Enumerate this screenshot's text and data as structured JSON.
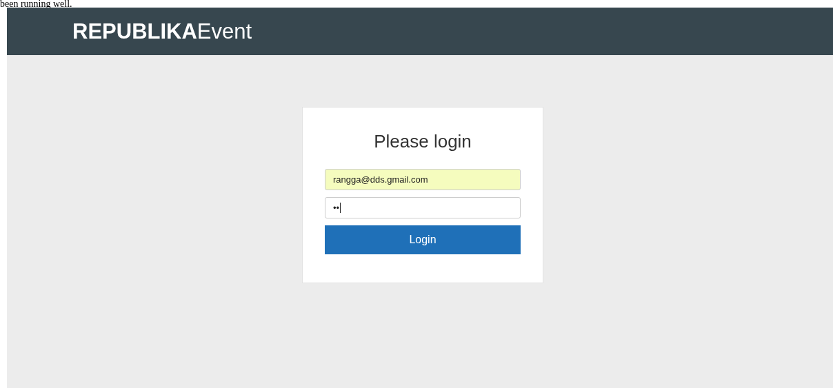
{
  "caption": "been running well.",
  "header": {
    "brand_bold": "REPUBLIKA",
    "brand_light": "Event"
  },
  "login": {
    "title": "Please login",
    "email": {
      "value": "rangga@dds.gmail.com",
      "autofilled": true
    },
    "password": {
      "value": "••",
      "focused": true
    },
    "button": "Login"
  }
}
